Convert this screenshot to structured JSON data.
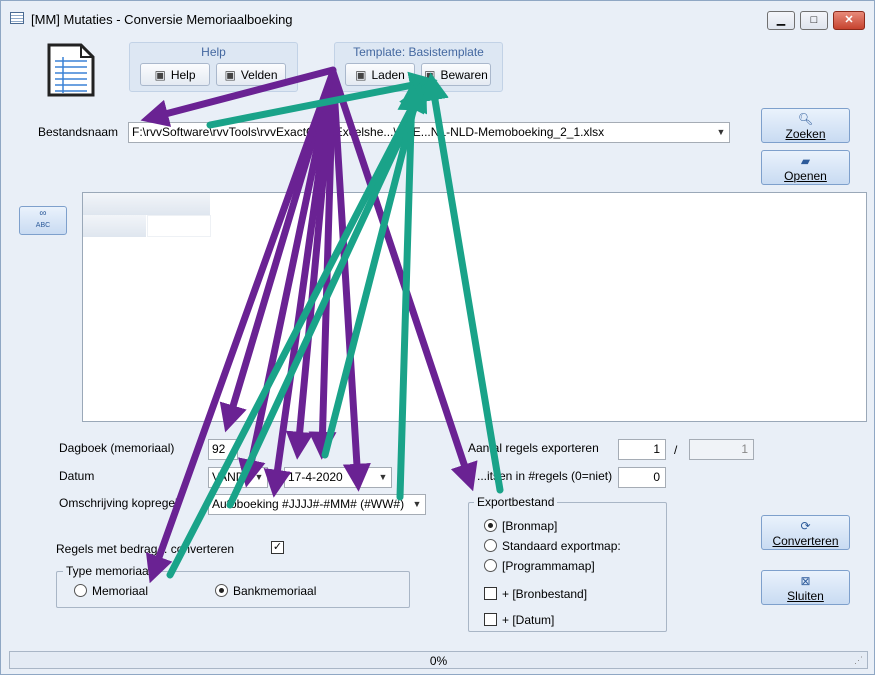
{
  "window": {
    "title": "[MM]  Mutaties - Conversie Memoriaalboeking",
    "minimize": "▁",
    "maximize": "□",
    "close": "✕"
  },
  "help_group": {
    "title": "Help",
    "help_label": "Help",
    "velden_label": "Velden"
  },
  "template_group": {
    "title": "Template: Basistemplate",
    "laden_label": "Laden",
    "bewaren_label": "Bewaren"
  },
  "bestandsnaam": {
    "label": "Bestandsnaam",
    "value": "F:\\rvvSoftware\\rvvTools\\rvvExactCo...\\Excelshe...\\rvvE...NL-NLD-Memoboeking_2_1.xlsx"
  },
  "zoeken_label": "Zoeken",
  "openen_label": "Openen",
  "left_tool_label": "ABC",
  "dagboek": {
    "label": "Dagboek (memoriaal)",
    "value": "92"
  },
  "datum": {
    "label": "Datum",
    "mode": "VAND",
    "value": "17-4-2020"
  },
  "omschrijving": {
    "label": "Omschrijving kopregel",
    "value": "Autoboeking #JJJJ#-#MM# (#WW#)"
  },
  "regels_bedrag": {
    "label": "Regels met bedrag... converteren",
    "checked": true,
    "mark": "✓"
  },
  "type_memoriaal": {
    "title": "Type memoriaal",
    "option_memoriaal": "Memoriaal",
    "option_bankmemoriaal": "Bankmemoriaal",
    "selected": "Bankmemoriaal"
  },
  "aantal_regels": {
    "label": "Aantal regels exporteren",
    "value": "1",
    "separator": "/",
    "total": "1"
  },
  "uitsplitsen": {
    "label": "...itsen in #regels (0=niet)",
    "value": "0"
  },
  "exportbestand": {
    "title": "Exportbestand",
    "options": [
      "[Bronmap]",
      "Standaard exportmap:",
      "[Programmamap]"
    ],
    "selected": "[Bronmap]",
    "check_bronbestand": "+ [Bronbestand]",
    "check_datum": "+ [Datum]"
  },
  "converteren_label": "Converteren",
  "sluiten_label": "Sluiten",
  "status": {
    "progress": "0%"
  },
  "colors": {
    "purple_arrow": "#6a2293",
    "teal_arrow": "#1aa389",
    "accent": "#4468a0"
  }
}
